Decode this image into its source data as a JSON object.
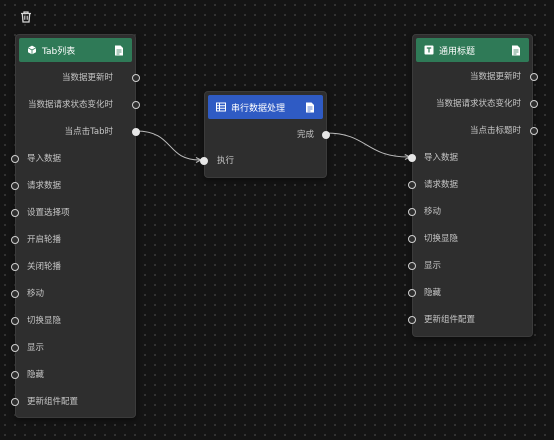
{
  "toolbar": {
    "delete_icon": "trash-icon"
  },
  "colors": {
    "canvas": "#141414",
    "node": "#2e2e2e",
    "header_green": "#2f7a57",
    "header_blue": "#2f5bc4",
    "wire": "#bdbdbd"
  },
  "nodes": [
    {
      "title": "Tab列表",
      "icon": "cube-icon",
      "outputs": [
        "当数据更新时",
        "当数据请求状态变化时",
        "当点击Tab时"
      ],
      "inputs": [
        "导入数据",
        "请求数据",
        "设置选择项",
        "开启轮播",
        "关闭轮播",
        "移动",
        "切换显隐",
        "显示",
        "隐藏",
        "更新组件配置"
      ]
    },
    {
      "title": "串行数据处理",
      "icon": "grid-icon",
      "outputs": [
        "完成"
      ],
      "inputs": [
        "执行"
      ]
    },
    {
      "title": "通用标题",
      "icon": "title-icon",
      "outputs": [
        "当数据更新时",
        "当数据请求状态变化时",
        "当点击标题时"
      ],
      "inputs": [
        "导入数据",
        "请求数据",
        "移动",
        "切换显隐",
        "显示",
        "隐藏",
        "更新组件配置"
      ]
    }
  ]
}
